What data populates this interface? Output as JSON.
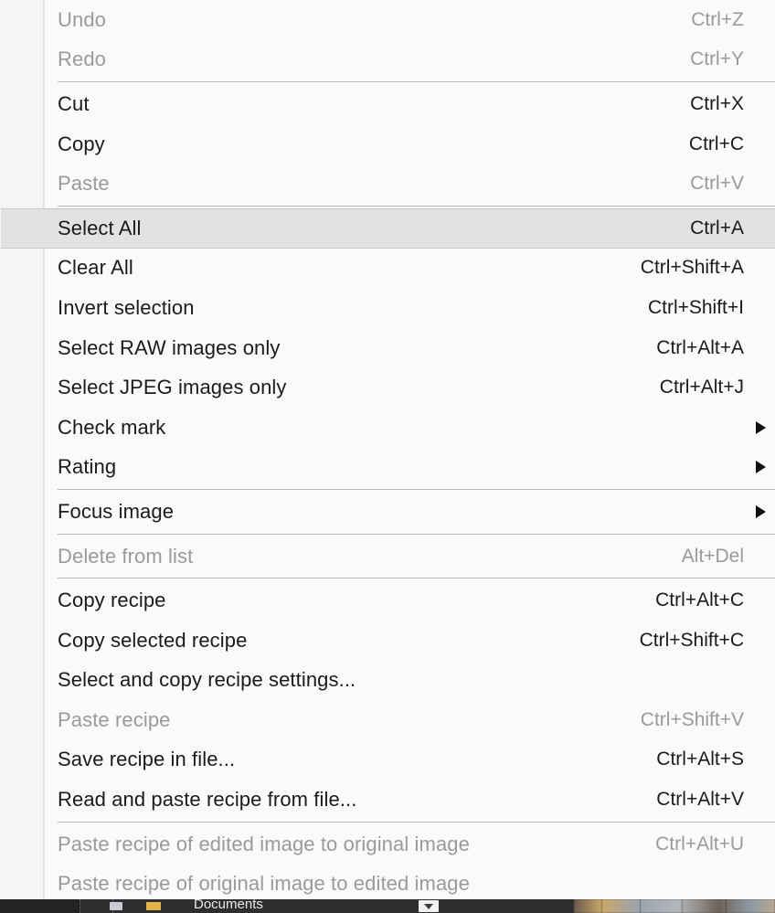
{
  "menu": {
    "name": "edit-context-menu",
    "groups": [
      {
        "items": [
          {
            "label": "Undo",
            "shortcut": "Ctrl+Z",
            "enabled": false,
            "submenu": false,
            "highlighted": false
          },
          {
            "label": "Redo",
            "shortcut": "Ctrl+Y",
            "enabled": false,
            "submenu": false,
            "highlighted": false
          }
        ]
      },
      {
        "items": [
          {
            "label": "Cut",
            "shortcut": "Ctrl+X",
            "enabled": true,
            "submenu": false,
            "highlighted": false
          },
          {
            "label": "Copy",
            "shortcut": "Ctrl+C",
            "enabled": true,
            "submenu": false,
            "highlighted": false
          },
          {
            "label": "Paste",
            "shortcut": "Ctrl+V",
            "enabled": false,
            "submenu": false,
            "highlighted": false
          }
        ]
      },
      {
        "items": [
          {
            "label": "Select All",
            "shortcut": "Ctrl+A",
            "enabled": true,
            "submenu": false,
            "highlighted": true
          },
          {
            "label": "Clear All",
            "shortcut": "Ctrl+Shift+A",
            "enabled": true,
            "submenu": false,
            "highlighted": false
          },
          {
            "label": "Invert selection",
            "shortcut": "Ctrl+Shift+I",
            "enabled": true,
            "submenu": false,
            "highlighted": false
          },
          {
            "label": "Select RAW images only",
            "shortcut": "Ctrl+Alt+A",
            "enabled": true,
            "submenu": false,
            "highlighted": false
          },
          {
            "label": "Select JPEG images only",
            "shortcut": "Ctrl+Alt+J",
            "enabled": true,
            "submenu": false,
            "highlighted": false
          },
          {
            "label": "Check mark",
            "shortcut": "",
            "enabled": true,
            "submenu": true,
            "highlighted": false
          },
          {
            "label": "Rating",
            "shortcut": "",
            "enabled": true,
            "submenu": true,
            "highlighted": false
          }
        ]
      },
      {
        "items": [
          {
            "label": "Focus image",
            "shortcut": "",
            "enabled": true,
            "submenu": true,
            "highlighted": false
          }
        ]
      },
      {
        "items": [
          {
            "label": "Delete from list",
            "shortcut": "Alt+Del",
            "enabled": false,
            "submenu": false,
            "highlighted": false
          }
        ]
      },
      {
        "items": [
          {
            "label": "Copy recipe",
            "shortcut": "Ctrl+Alt+C",
            "enabled": true,
            "submenu": false,
            "highlighted": false
          },
          {
            "label": "Copy selected recipe",
            "shortcut": "Ctrl+Shift+C",
            "enabled": true,
            "submenu": false,
            "highlighted": false
          },
          {
            "label": "Select and copy recipe settings...",
            "shortcut": "",
            "enabled": true,
            "submenu": false,
            "highlighted": false
          },
          {
            "label": "Paste recipe",
            "shortcut": "Ctrl+Shift+V",
            "enabled": false,
            "submenu": false,
            "highlighted": false
          },
          {
            "label": "Save recipe in file...",
            "shortcut": "Ctrl+Alt+S",
            "enabled": true,
            "submenu": false,
            "highlighted": false
          },
          {
            "label": "Read and paste recipe from file...",
            "shortcut": "Ctrl+Alt+V",
            "enabled": true,
            "submenu": false,
            "highlighted": false
          }
        ]
      },
      {
        "items": [
          {
            "label": "Paste recipe of edited image to original image",
            "shortcut": "Ctrl+Alt+U",
            "enabled": false,
            "submenu": false,
            "highlighted": false
          },
          {
            "label": "Paste recipe of original image to edited image",
            "shortcut": "",
            "enabled": false,
            "submenu": false,
            "highlighted": false
          }
        ]
      }
    ]
  },
  "taskbar": {
    "documents_label": "Documents"
  },
  "colors": {
    "menu_background": "#fafaf8",
    "highlight_background": "#e2e2e0",
    "highlight_border": "#c9c9c7",
    "text_enabled": "#1b1b1b",
    "text_disabled": "#9a9a9a",
    "separator": "#b8b8b6",
    "taskbar_background": "#2e2e2e"
  }
}
